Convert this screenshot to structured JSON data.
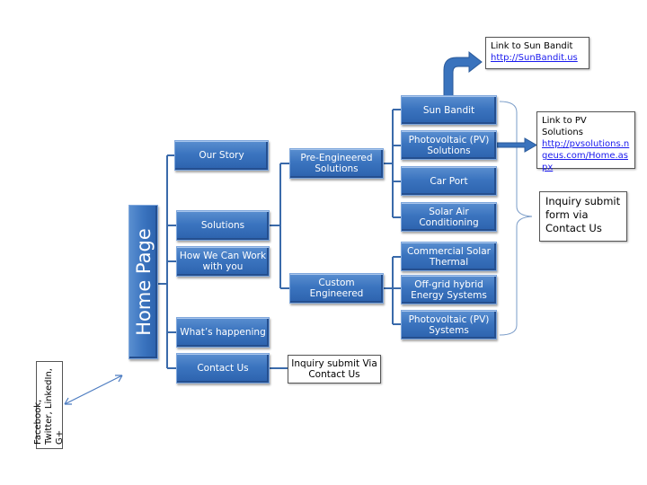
{
  "diagram": {
    "root": "Home Page",
    "main_nav": [
      {
        "label": "Our Story"
      },
      {
        "label": "Solutions"
      },
      {
        "label": "How We Can Work with you"
      },
      {
        "label": "What’s happening"
      },
      {
        "label": "Contact Us"
      }
    ],
    "solutions_children": [
      {
        "label": "Pre-Engineered Solutions"
      },
      {
        "label": "Custom Engineered"
      }
    ],
    "pre_engineered_children": [
      {
        "label": "Sun Bandit"
      },
      {
        "label": "Photovoltaic (PV) Solutions"
      },
      {
        "label": "Car Port"
      },
      {
        "label": "Solar Air Conditioning"
      }
    ],
    "custom_engineered_children": [
      {
        "label": "Commercial Solar Thermal"
      },
      {
        "label": "Off-grid hybrid Energy Systems"
      },
      {
        "label": "Photovoltaic (PV) Systems"
      }
    ],
    "notes": {
      "sun_bandit_link": {
        "title": "Link to Sun Bandit",
        "url": "http://SunBandit.us"
      },
      "pv_link": {
        "title": "Link to PV Solutions",
        "url": "http://pvsolutions.ngeus.com/Home.aspx"
      },
      "inquiry_form": "Inquiry submit form via Contact Us",
      "contact_inquiry": "Inquiry submit Via Contact Us",
      "social": "Facebook, Twitter, LinkedIn, G+"
    },
    "colors": {
      "node_fill": "#3b74bf",
      "connector": "#3a6aaa",
      "bracket": "#7a9cc8",
      "link": "#1a1aee"
    }
  }
}
